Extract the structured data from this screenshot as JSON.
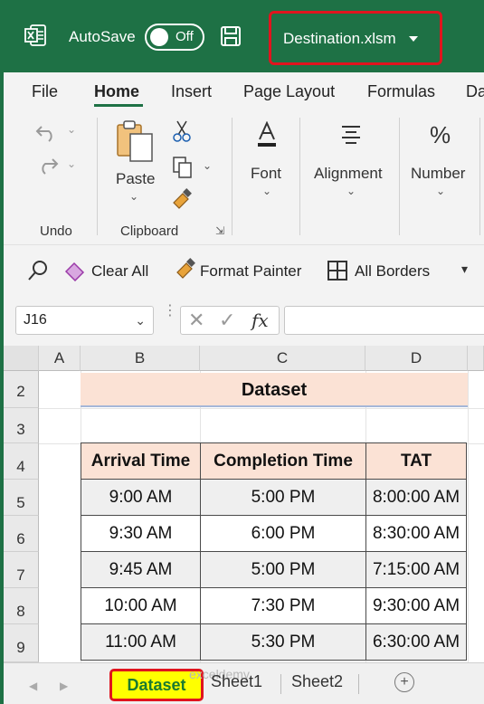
{
  "titlebar": {
    "autosave_label": "AutoSave",
    "autosave_state": "Off",
    "filename": "Destination.xlsm"
  },
  "menu": {
    "tabs": [
      "File",
      "Home",
      "Insert",
      "Page Layout",
      "Formulas",
      "Da"
    ],
    "active": "Home"
  },
  "ribbon": {
    "undo_group": "Undo",
    "paste_label": "Paste",
    "clipboard_group": "Clipboard",
    "font_label": "Font",
    "alignment_label": "Alignment",
    "number_label": "Number"
  },
  "quick_access": {
    "clear_all": "Clear All",
    "format_painter": "Format Painter",
    "all_borders": "All Borders"
  },
  "formula_bar": {
    "name_box": "J16",
    "fx_label": "fx",
    "formula": ""
  },
  "grid": {
    "columns": [
      "A",
      "B",
      "C",
      "D"
    ],
    "rows": [
      "2",
      "3",
      "4",
      "5",
      "6",
      "7",
      "8",
      "9"
    ],
    "title": "Dataset",
    "headers": [
      "Arrival Time",
      "Completion Time",
      "TAT"
    ],
    "data": [
      [
        "9:00 AM",
        "5:00 PM",
        "8:00:00 AM"
      ],
      [
        "9:30 AM",
        "6:00 PM",
        "8:30:00 AM"
      ],
      [
        "9:45 AM",
        "5:00 PM",
        "7:15:00 AM"
      ],
      [
        "10:00 AM",
        "7:30 PM",
        "9:30:00 AM"
      ],
      [
        "11:00 AM",
        "5:30 PM",
        "6:30:00 AM"
      ]
    ]
  },
  "sheets": {
    "tabs": [
      "Dataset",
      "Sheet1",
      "Sheet2"
    ],
    "active": "Dataset",
    "watermark": "exceldemy"
  },
  "colors": {
    "title_bar": "#1e7145",
    "highlight_border": "#e0141e",
    "header_fill": "#fbe2d5",
    "active_tab_fill": "#ffff00"
  }
}
